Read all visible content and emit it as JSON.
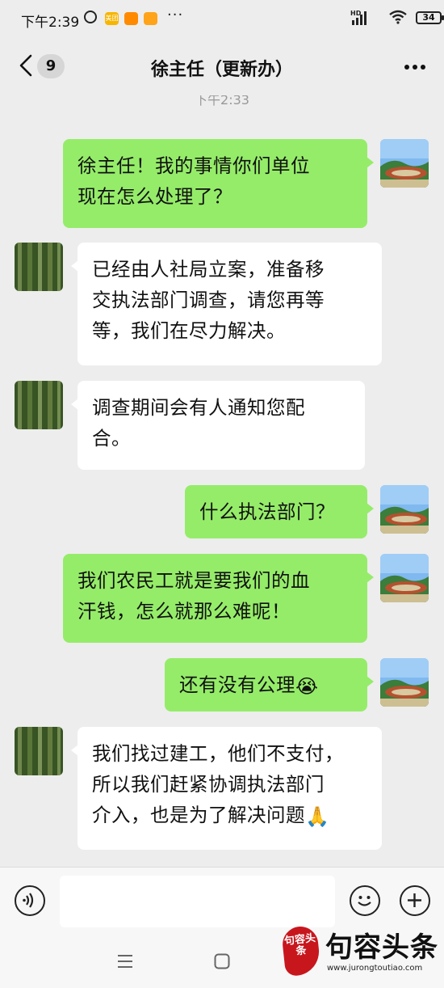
{
  "status_bar": {
    "time": "下午2:39",
    "app1_label": "美团",
    "network": "HD",
    "battery": "34"
  },
  "nav": {
    "unread_count": "9",
    "title": "徐主任（更新办）"
  },
  "chat": {
    "timestamp": "下午2:33",
    "messages": [
      {
        "from": "me",
        "lines": [
          "徐主任！我的事情你们单位",
          "现在怎么处理了？"
        ]
      },
      {
        "from": "them",
        "lines": [
          "已经由人社局立案，准备移",
          "交执法部门调查，请您再等",
          "等，我们在尽力解决。"
        ]
      },
      {
        "from": "them",
        "lines": [
          "调查期间会有人通知您配",
          "合。"
        ]
      },
      {
        "from": "me",
        "lines": [
          "什么执法部门？"
        ]
      },
      {
        "from": "me",
        "lines": [
          "我们农民工就是要我们的血",
          "汗钱，怎么就那么难呢！"
        ]
      },
      {
        "from": "me",
        "lines": [
          "还有没有公理"
        ],
        "emoji": "😭"
      },
      {
        "from": "them",
        "lines": [
          "我们找过建工，他们不支付，",
          "所以我们赶紧协调执法部门",
          "介入，也是为了解决问题"
        ],
        "emoji": "🙏"
      }
    ]
  },
  "input": {
    "placeholder": ""
  },
  "watermark": {
    "seal_text": "句容头条",
    "brand": "句容头条",
    "url": "www.jurongtoutiao.com"
  },
  "icons": [
    "alarm-icon",
    "back-chevron-icon",
    "more-icon",
    "voice-icon",
    "emoji-icon",
    "plus-icon",
    "menu-icon",
    "home-icon"
  ],
  "colors": {
    "my_bubble": "#95ec69",
    "their_bubble": "#ffffff",
    "background": "#ededed",
    "watermark_red": "#c8161d"
  }
}
